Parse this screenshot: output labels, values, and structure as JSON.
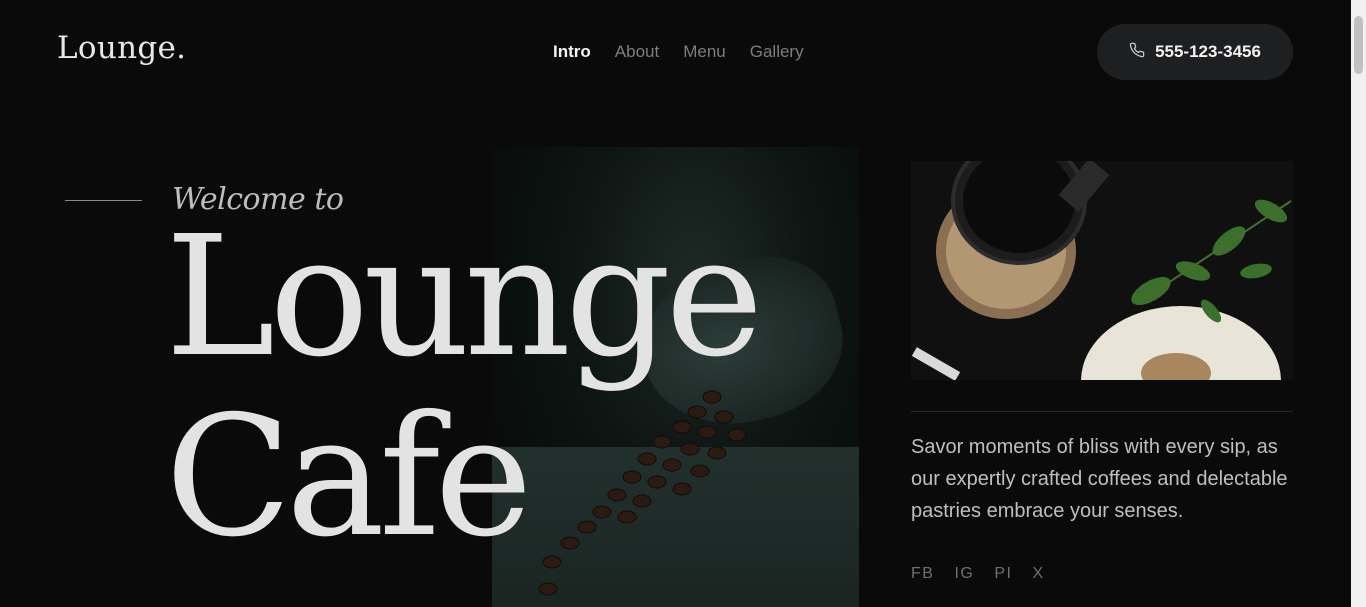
{
  "header": {
    "logo": "Lounge.",
    "nav": [
      {
        "label": "Intro",
        "active": true
      },
      {
        "label": "About",
        "active": false
      },
      {
        "label": "Menu",
        "active": false
      },
      {
        "label": "Gallery",
        "active": false
      }
    ],
    "phone": {
      "icon": "phone-icon",
      "label": "555-123-3456"
    }
  },
  "hero": {
    "kicker": "Welcome to",
    "title_line1": "Lounge",
    "title_line2": "Cafe"
  },
  "side": {
    "description": "Savor moments of bliss with every sip, as our expertly crafted coffees and delectable pastries embrace your senses.",
    "socials": [
      "FB",
      "IG",
      "PI",
      "X"
    ]
  },
  "colors": {
    "background": "#0a0a0b",
    "accent_text": "#e3e3e3",
    "muted_text": "#7d7d80",
    "button_bg": "#1e1f21"
  }
}
